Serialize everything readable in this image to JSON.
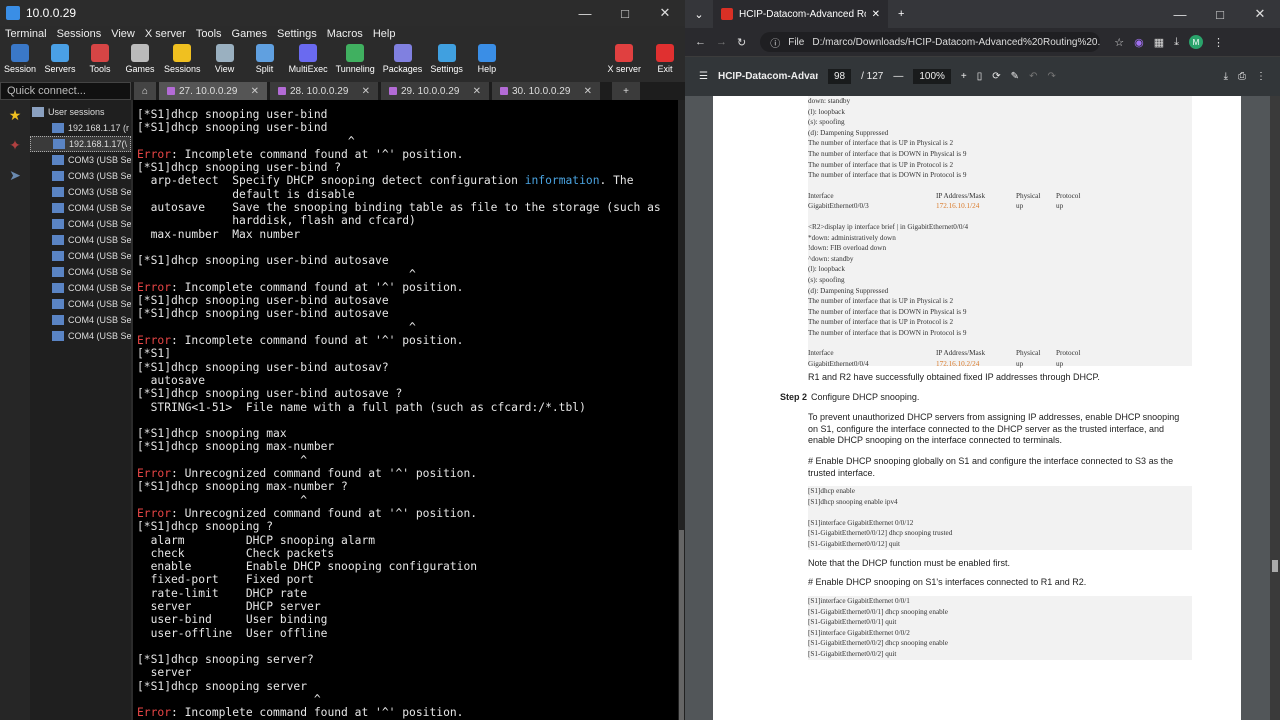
{
  "left": {
    "title": "10.0.0.29",
    "menu": [
      "Terminal",
      "Sessions",
      "View",
      "X server",
      "Tools",
      "Games",
      "Settings",
      "Macros",
      "Help"
    ],
    "toolbar": [
      {
        "label": "Session",
        "color": "#3a78c8"
      },
      {
        "label": "Servers",
        "color": "#4aa0e6"
      },
      {
        "label": "Tools",
        "color": "#d64545"
      },
      {
        "label": "Games",
        "color": "#bbbbbb"
      },
      {
        "label": "Sessions",
        "color": "#f0c020"
      },
      {
        "label": "View",
        "color": "#9ab0c0"
      },
      {
        "label": "Split",
        "color": "#60a0e0"
      },
      {
        "label": "MultiExec",
        "color": "#6a6af0"
      },
      {
        "label": "Tunneling",
        "color": "#40b060"
      },
      {
        "label": "Packages",
        "color": "#8080e0"
      },
      {
        "label": "Settings",
        "color": "#40a0e0"
      },
      {
        "label": "Help",
        "color": "#3a8ee6"
      }
    ],
    "toolbar_right": [
      {
        "label": "X server",
        "color": "#e04040"
      },
      {
        "label": "Exit",
        "color": "#e03030"
      }
    ],
    "quick_placeholder": "Quick connect...",
    "tabs": [
      "27. 10.0.0.29",
      "28. 10.0.0.29",
      "29. 10.0.0.29",
      "30. 10.0.0.29"
    ],
    "sessions_header": "User sessions",
    "sessions": [
      "192.168.1.17 (r",
      "192.168.1.17(\\",
      "COM3  (USB Ser",
      "COM3  (USB Ser",
      "COM3  (USB Ser",
      "COM4  (USB Ser",
      "COM4  (USB Ser",
      "COM4  (USB Ser",
      "COM4  (USB Ser",
      "COM4  (USB Ser",
      "COM4  (USB Ser",
      "COM4  (USB Ser",
      "COM4  (USB Ser",
      "COM4  (USB Ser"
    ]
  },
  "terminal": [
    {
      "t": "[*S1]dhcp snooping user-bind"
    },
    {
      "t": "[*S1]dhcp snooping user-bind"
    },
    {
      "t": "                               ^"
    },
    {
      "t": "",
      "e": "Error",
      "r": ": Incomplete command found at '^' position."
    },
    {
      "t": "[*S1]dhcp snooping user-bind ?"
    },
    {
      "t": "  arp-detect  Specify DHCP snooping detect configuration ",
      "h": "information",
      "r": ". The"
    },
    {
      "t": "              default is disable"
    },
    {
      "t": "  autosave    Save the snooping binding table as file to the storage (such as"
    },
    {
      "t": "              harddisk, flash and cfcard)"
    },
    {
      "t": "  max-number  Max number"
    },
    {
      "t": ""
    },
    {
      "t": "[*S1]dhcp snooping user-bind autosave"
    },
    {
      "t": "                                        ^"
    },
    {
      "t": "",
      "e": "Error",
      "r": ": Incomplete command found at '^' position."
    },
    {
      "t": "[*S1]dhcp snooping user-bind autosave"
    },
    {
      "t": "[*S1]dhcp snooping user-bind autosave"
    },
    {
      "t": "                                        ^"
    },
    {
      "t": "",
      "e": "Error",
      "r": ": Incomplete command found at '^' position."
    },
    {
      "t": "[*S1]"
    },
    {
      "t": "[*S1]dhcp snooping user-bind autosav?"
    },
    {
      "t": "  autosave"
    },
    {
      "t": "[*S1]dhcp snooping user-bind autosave ?"
    },
    {
      "t": "  STRING<1-51>  File name with a full path (such as cfcard:/*.tbl)"
    },
    {
      "t": ""
    },
    {
      "t": "[*S1]dhcp snooping max"
    },
    {
      "t": "[*S1]dhcp snooping max-number"
    },
    {
      "t": "                        ^"
    },
    {
      "t": "",
      "e": "Error",
      "r": ": Unrecognized command found at '^' position."
    },
    {
      "t": "[*S1]dhcp snooping max-number ?"
    },
    {
      "t": "                        ^"
    },
    {
      "t": "",
      "e": "Error",
      "r": ": Unrecognized command found at '^' position."
    },
    {
      "t": "[*S1]dhcp snooping ?"
    },
    {
      "t": "  alarm         DHCP snooping alarm"
    },
    {
      "t": "  check         Check packets"
    },
    {
      "t": "  enable        Enable DHCP snooping configuration"
    },
    {
      "t": "  fixed-port    Fixed port"
    },
    {
      "t": "  rate-limit    DHCP rate"
    },
    {
      "t": "  server        DHCP server"
    },
    {
      "t": "  user-bind     User binding"
    },
    {
      "t": "  user-offline  User offline"
    },
    {
      "t": ""
    },
    {
      "t": "[*S1]dhcp snooping server?"
    },
    {
      "t": "  server"
    },
    {
      "t": "[*S1]dhcp snooping server"
    },
    {
      "t": "                          ^"
    },
    {
      "t": "",
      "e": "Error",
      "r": ": Incomplete command found at '^' position."
    }
  ],
  "right": {
    "tab_title": "HCIP-Datacom-Advanced Routi",
    "url_scheme": "File",
    "url": "D:/marco/Downloads/HCIP-Datacom-Advanced%20Routing%20...",
    "pdf_title": "HCIP-Datacom-Advan...",
    "page_current": "98",
    "page_total": "/ 127",
    "zoom": "100%",
    "block1": [
      "down: standby",
      "(l): loopback",
      "(s): spoofing",
      "(d): Dampening Suppressed",
      "The number of interface that is UP in Physical is 2",
      "The number of interface that is DOWN in Physical is 9",
      "The number of interface that is UP in Protocol is 2",
      "The number of interface that is DOWN in Protocol is 9"
    ],
    "table_header": [
      "Interface",
      "IP Address/Mask",
      "Physical",
      "Protocol"
    ],
    "row1": [
      "GigabitEthernet0/0/3",
      "172.16.10.1/24",
      "up",
      "up"
    ],
    "block2": [
      "<R2>display ip interface brief | in GigabitEthernet0/0/4",
      "*down: administratively down",
      "!down: FIB overload down",
      "^down: standby",
      "(l): loopback",
      "(s): spoofing",
      "(d): Dampening Suppressed",
      "The number of interface that is UP in Physical is 2",
      "The number of interface that is DOWN in Physical is 9",
      "The number of interface that is UP in Protocol is 2",
      "The number of interface that is DOWN in Protocol is 9"
    ],
    "row2": [
      "GigabitEthernet0/0/4",
      "172.16.10.2/24",
      "up",
      "up"
    ],
    "p1": "R1 and R2 have successfully obtained fixed IP addresses through DHCP.",
    "step_label": "Step 2",
    "step_text": "Configure DHCP snooping.",
    "p2": "To prevent unauthorized DHCP servers from assigning IP addresses, enable DHCP snooping on S1, configure the interface connected to the DHCP server as the trusted interface, and enable DHCP snooping on the interface connected to terminals.",
    "p3": "# Enable DHCP snooping globally on S1 and configure the interface connected to S3 as the trusted interface.",
    "code1": [
      "[S1]dhcp enable",
      "[S1]dhcp snooping enable ipv4",
      "",
      "[S1]interface GigabitEthernet 0/0/12",
      "[S1-GigabitEthernet0/0/12] dhcp snooping trusted",
      "[S1-GigabitEthernet0/0/12] quit"
    ],
    "p4": "Note that the DHCP function must be enabled first.",
    "p5": "# Enable DHCP snooping on S1's interfaces connected to R1 and R2.",
    "code2": [
      "[S1]interface GigabitEthernet 0/0/1",
      "[S1-GigabitEthernet0/0/1] dhcp snooping enable",
      "[S1-GigabitEthernet0/0/1] quit",
      "[S1]interface GigabitEthernet 0/0/2",
      "[S1-GigabitEthernet0/0/2] dhcp snooping enable",
      "[S1-GigabitEthernet0/0/2] quit"
    ]
  }
}
